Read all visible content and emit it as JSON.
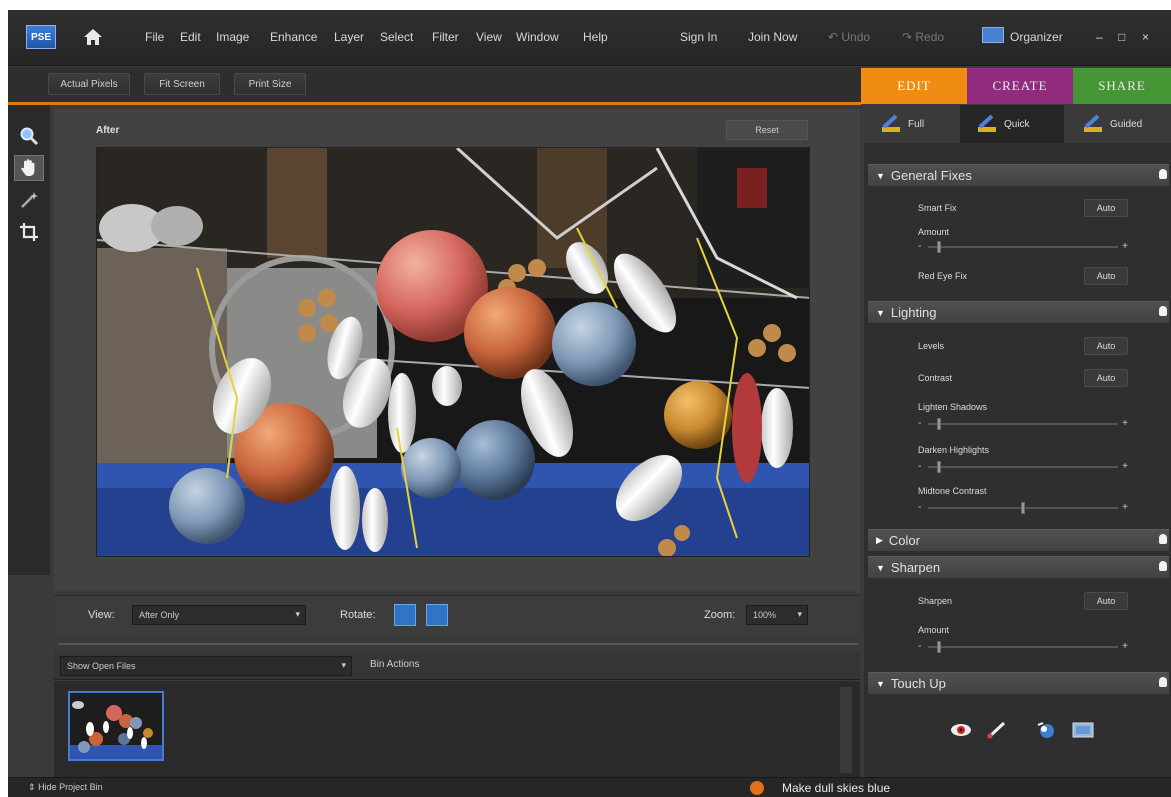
{
  "app": {
    "logo_text": "PSE"
  },
  "menu": {
    "items": [
      "File",
      "Edit",
      "Image",
      "Enhance",
      "Layer",
      "Select",
      "Filter",
      "View",
      "Window",
      "Help"
    ],
    "sign_in": "Sign In",
    "join_now": "Join Now",
    "undo": "Undo",
    "redo": "Redo",
    "organizer": "Organizer",
    "window_controls": [
      "–",
      "□",
      "×"
    ]
  },
  "toolbar": {
    "actual_pixels": "Actual Pixels",
    "fit_screen": "Fit Screen",
    "print_size": "Print Size"
  },
  "mode_tabs": [
    {
      "label": "EDIT",
      "color": "#f08c12",
      "active": true
    },
    {
      "label": "CREATE",
      "color": "#9c2a86",
      "active": false
    },
    {
      "label": "SHARE",
      "color": "#49a135",
      "active": false
    }
  ],
  "edit_tabs": [
    {
      "label": "Full",
      "icon": "pencil-ruler-icon"
    },
    {
      "label": "Quick",
      "icon": "pencil-ruler-icon",
      "active": true
    },
    {
      "label": "Guided",
      "icon": "pencil-ruler-icon"
    }
  ],
  "tools": [
    "zoom-tool-icon",
    "hand-tool-icon",
    "magic-wand-icon",
    "crop-tool-icon"
  ],
  "canvas": {
    "label": "After",
    "reset_label": "Reset"
  },
  "viewbar": {
    "view_label": "View:",
    "view_value": "After Only",
    "rotate_label": "Rotate:",
    "zoom_label": "Zoom:",
    "zoom_value": "100%"
  },
  "bin": {
    "select_value": "Show Open Files",
    "actions_label": "Bin Actions"
  },
  "status": {
    "hide_bin": "Hide Project Bin",
    "tip": "Make dull skies blue"
  },
  "panel": {
    "general_fixes": {
      "title": "General Fixes",
      "smart_fix": "Smart Fix",
      "amount": "Amount",
      "red_eye_fix": "Red Eye Fix",
      "auto": "Auto",
      "amount_level": 0.05
    },
    "lighting": {
      "title": "Lighting",
      "levels": "Levels",
      "contrast": "Contrast",
      "lighten_shadows": "Lighten Shadows",
      "darken_highlights": "Darken Highlights",
      "midtone_contrast": "Midtone Contrast",
      "auto": "Auto",
      "lighten_level": 0.05,
      "darken_level": 0.05,
      "midtone_level": 0.5
    },
    "color": {
      "title": "Color"
    },
    "sharpen": {
      "title": "Sharpen",
      "sharpen_label": "Sharpen",
      "amount": "Amount",
      "auto": "Auto",
      "amount_level": 0.05
    },
    "touch_up": {
      "title": "Touch Up",
      "tools": [
        "red-eye-icon",
        "whiten-teeth-icon",
        "blue-skies-icon",
        "black-white-icon"
      ]
    }
  }
}
